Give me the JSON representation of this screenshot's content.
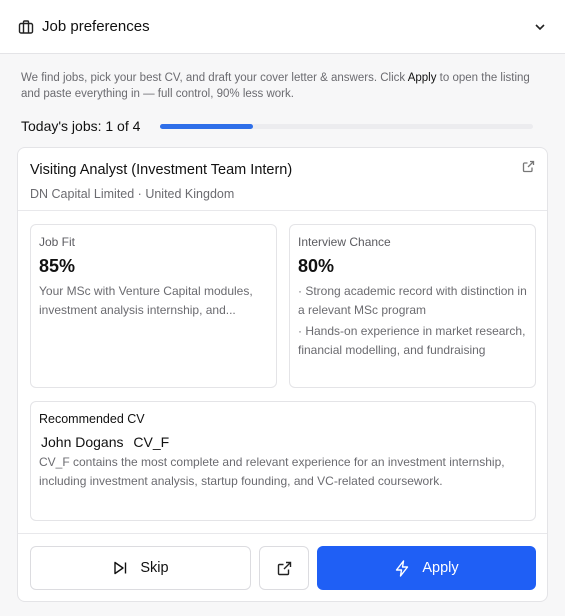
{
  "header": {
    "title": "Job preferences",
    "icon": "briefcase-icon",
    "toggle_icon": "chevron-down-icon"
  },
  "intro": {
    "text_before": "We find jobs, pick your best CV, and draft your cover letter & answers. Click ",
    "apply_word": "Apply",
    "text_after": " to open the listing and paste everything in — full control, 90% less work."
  },
  "progress": {
    "label": "Today's jobs: 1 of 4",
    "current": 1,
    "total": 4,
    "fraction": 0.25,
    "color": "#2f6fe9"
  },
  "job": {
    "title": "Visiting Analyst (Investment Team Intern)",
    "subtitle": "DN Capital Limited · United Kingdom"
  },
  "job_fit": {
    "label": "Job Fit",
    "value": "85%",
    "text": "Your MSc with Venture Capital modules, investment analysis internship, and..."
  },
  "interview_chance": {
    "label": "Interview Chance",
    "value": "80%",
    "bullets": [
      "· Strong academic record with distinction in a relevant MSc program",
      "· Hands-on experience in market research, financial modelling, and fundraising"
    ]
  },
  "recommended_cv": {
    "label": "Recommended CV",
    "owner": "John Dogans",
    "file": "CV_F",
    "description": "CV_F contains the most complete and relevant experience for an investment internship, including investment analysis, startup founding, and VC-related coursework."
  },
  "actions": {
    "skip_label": "Skip",
    "apply_label": "Apply",
    "apply_color": "#1f5ff5"
  }
}
